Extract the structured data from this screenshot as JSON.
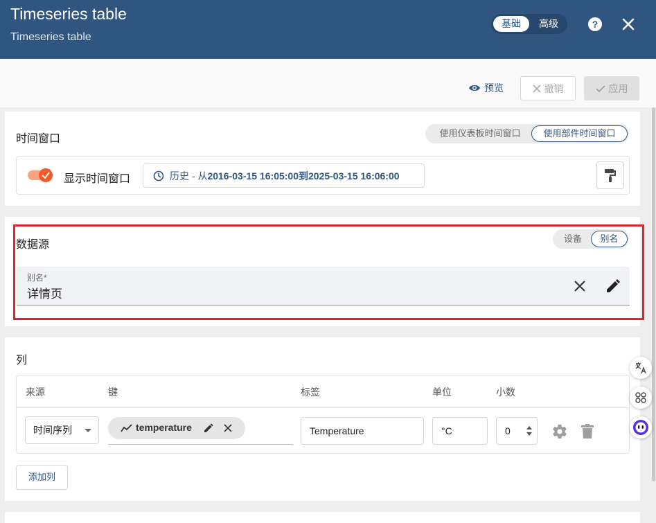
{
  "header": {
    "title": "Timeseries table",
    "subtitle": "Timeseries table",
    "mode_basic": "基础",
    "mode_advanced": "高级"
  },
  "toolbar": {
    "preview_label": "预览",
    "undo_label": "撤销",
    "apply_label": "应用"
  },
  "time_window": {
    "title": "时间窗口",
    "option_dashboard": "使用仪表板时间窗口",
    "option_widget": "使用部件时间窗口",
    "show_label": "显示时间窗口",
    "show_enabled": true,
    "value_prefix": "历史 - 从",
    "value_range": "2016-03-15 16:05:00到2025-03-15 16:06:00"
  },
  "datasource": {
    "title": "数据源",
    "option_device": "设备",
    "option_alias": "别名",
    "alias_field_label": "别名*",
    "alias_value": "详情页"
  },
  "columns": {
    "title": "列",
    "headers": {
      "source": "来源",
      "key": "键",
      "label": "标签",
      "unit": "单位",
      "decimals": "小数"
    },
    "rows": [
      {
        "source": "时间序列",
        "key": "temperature",
        "label": "Temperature",
        "unit": "°C",
        "decimals": "0"
      }
    ],
    "add_column_label": "添加列"
  },
  "colors": {
    "header_bg": "#305680",
    "accent": "#305680",
    "toggle_on": "#f05a28",
    "highlight_frame": "#e8202a"
  }
}
